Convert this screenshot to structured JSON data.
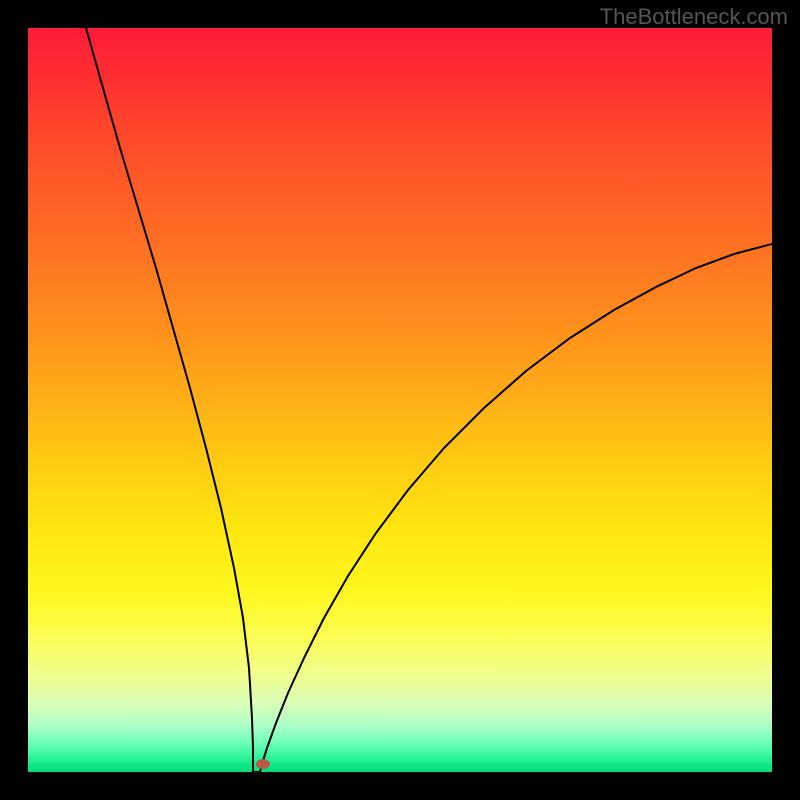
{
  "watermark": "TheBottleneck.com",
  "chart_data": {
    "type": "line",
    "title": "",
    "xlabel": "",
    "ylabel": "",
    "x_range": [
      0,
      100
    ],
    "y_range": [
      0,
      100
    ],
    "curve": {
      "description": "V-shaped bottleneck mismatch curve",
      "minimum_x": 30.5,
      "minimum_y": 0,
      "left_branch_top": {
        "x": 8,
        "y": 100
      },
      "right_branch_top": {
        "x": 100,
        "y": 70
      }
    },
    "marker": {
      "x": 31.5,
      "y": 1.2,
      "color": "#b85a4a"
    },
    "gradient_colors": {
      "top": "#ff1a3a",
      "middle": "#ffe810",
      "bottom": "#00db78"
    }
  }
}
